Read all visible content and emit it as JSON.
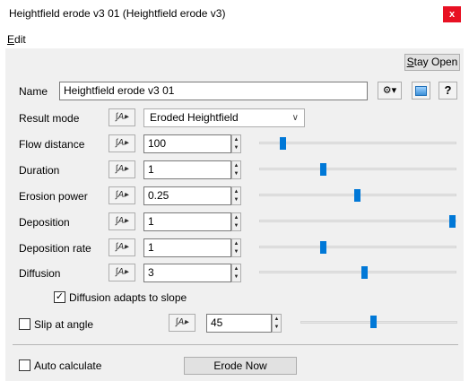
{
  "window": {
    "title": "Heightfield erode v3 01    (Heightfield erode v3)",
    "close_label": "x"
  },
  "menu": {
    "edit_label": "Edit"
  },
  "toolbar": {
    "stay_open_label": "Stay Open"
  },
  "name_field": {
    "label": "Name",
    "value": "Heightfield erode v3 01",
    "help_label": "?"
  },
  "result_mode": {
    "label": "Result mode",
    "selected": "Eroded Heightfield"
  },
  "params": [
    {
      "label": "Flow distance",
      "value": "100",
      "slider_fraction": 0.11
    },
    {
      "label": "Duration",
      "value": "1",
      "slider_fraction": 0.32
    },
    {
      "label": "Erosion power",
      "value": "0.25",
      "slider_fraction": 0.5
    },
    {
      "label": "Deposition",
      "value": "1",
      "slider_fraction": 1.0
    },
    {
      "label": "Deposition rate",
      "value": "1",
      "slider_fraction": 0.32
    },
    {
      "label": "Diffusion",
      "value": "3",
      "slider_fraction": 0.54
    }
  ],
  "diffusion_adapts": {
    "label": "Diffusion adapts to slope",
    "checked": true
  },
  "slip": {
    "label": "Slip at angle",
    "checked": false,
    "value": "45",
    "slider_fraction": 0.47
  },
  "auto_calc": {
    "label": "Auto calculate",
    "checked": false
  },
  "erode_now_label": "Erode Now",
  "curve_icon": "curve-menu-icon",
  "colors": {
    "accent": "#0078d7",
    "close": "#e81123",
    "panel": "#f0f0f0"
  }
}
